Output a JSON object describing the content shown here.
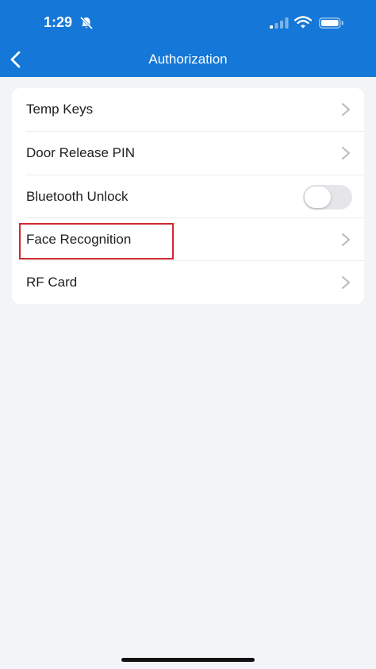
{
  "status_bar": {
    "time": "1:29",
    "bell_icon": "bell-slash-icon",
    "signal_icon": "cellular-signal-icon",
    "wifi_icon": "wifi-icon",
    "battery_icon": "battery-icon"
  },
  "nav": {
    "back_icon": "chevron-left-icon",
    "title": "Authorization"
  },
  "colors": {
    "header_bg": "#1577d7",
    "page_bg": "#f3f4f8",
    "highlight": "#d0282f"
  },
  "menu": {
    "items": [
      {
        "label": "Temp Keys",
        "accessory": "chevron"
      },
      {
        "label": "Door Release PIN",
        "accessory": "chevron"
      },
      {
        "label": "Bluetooth Unlock",
        "accessory": "toggle",
        "toggle_on": false
      },
      {
        "label": "Face Recognition",
        "accessory": "chevron",
        "highlighted": true
      },
      {
        "label": "RF Card",
        "accessory": "chevron"
      }
    ]
  }
}
